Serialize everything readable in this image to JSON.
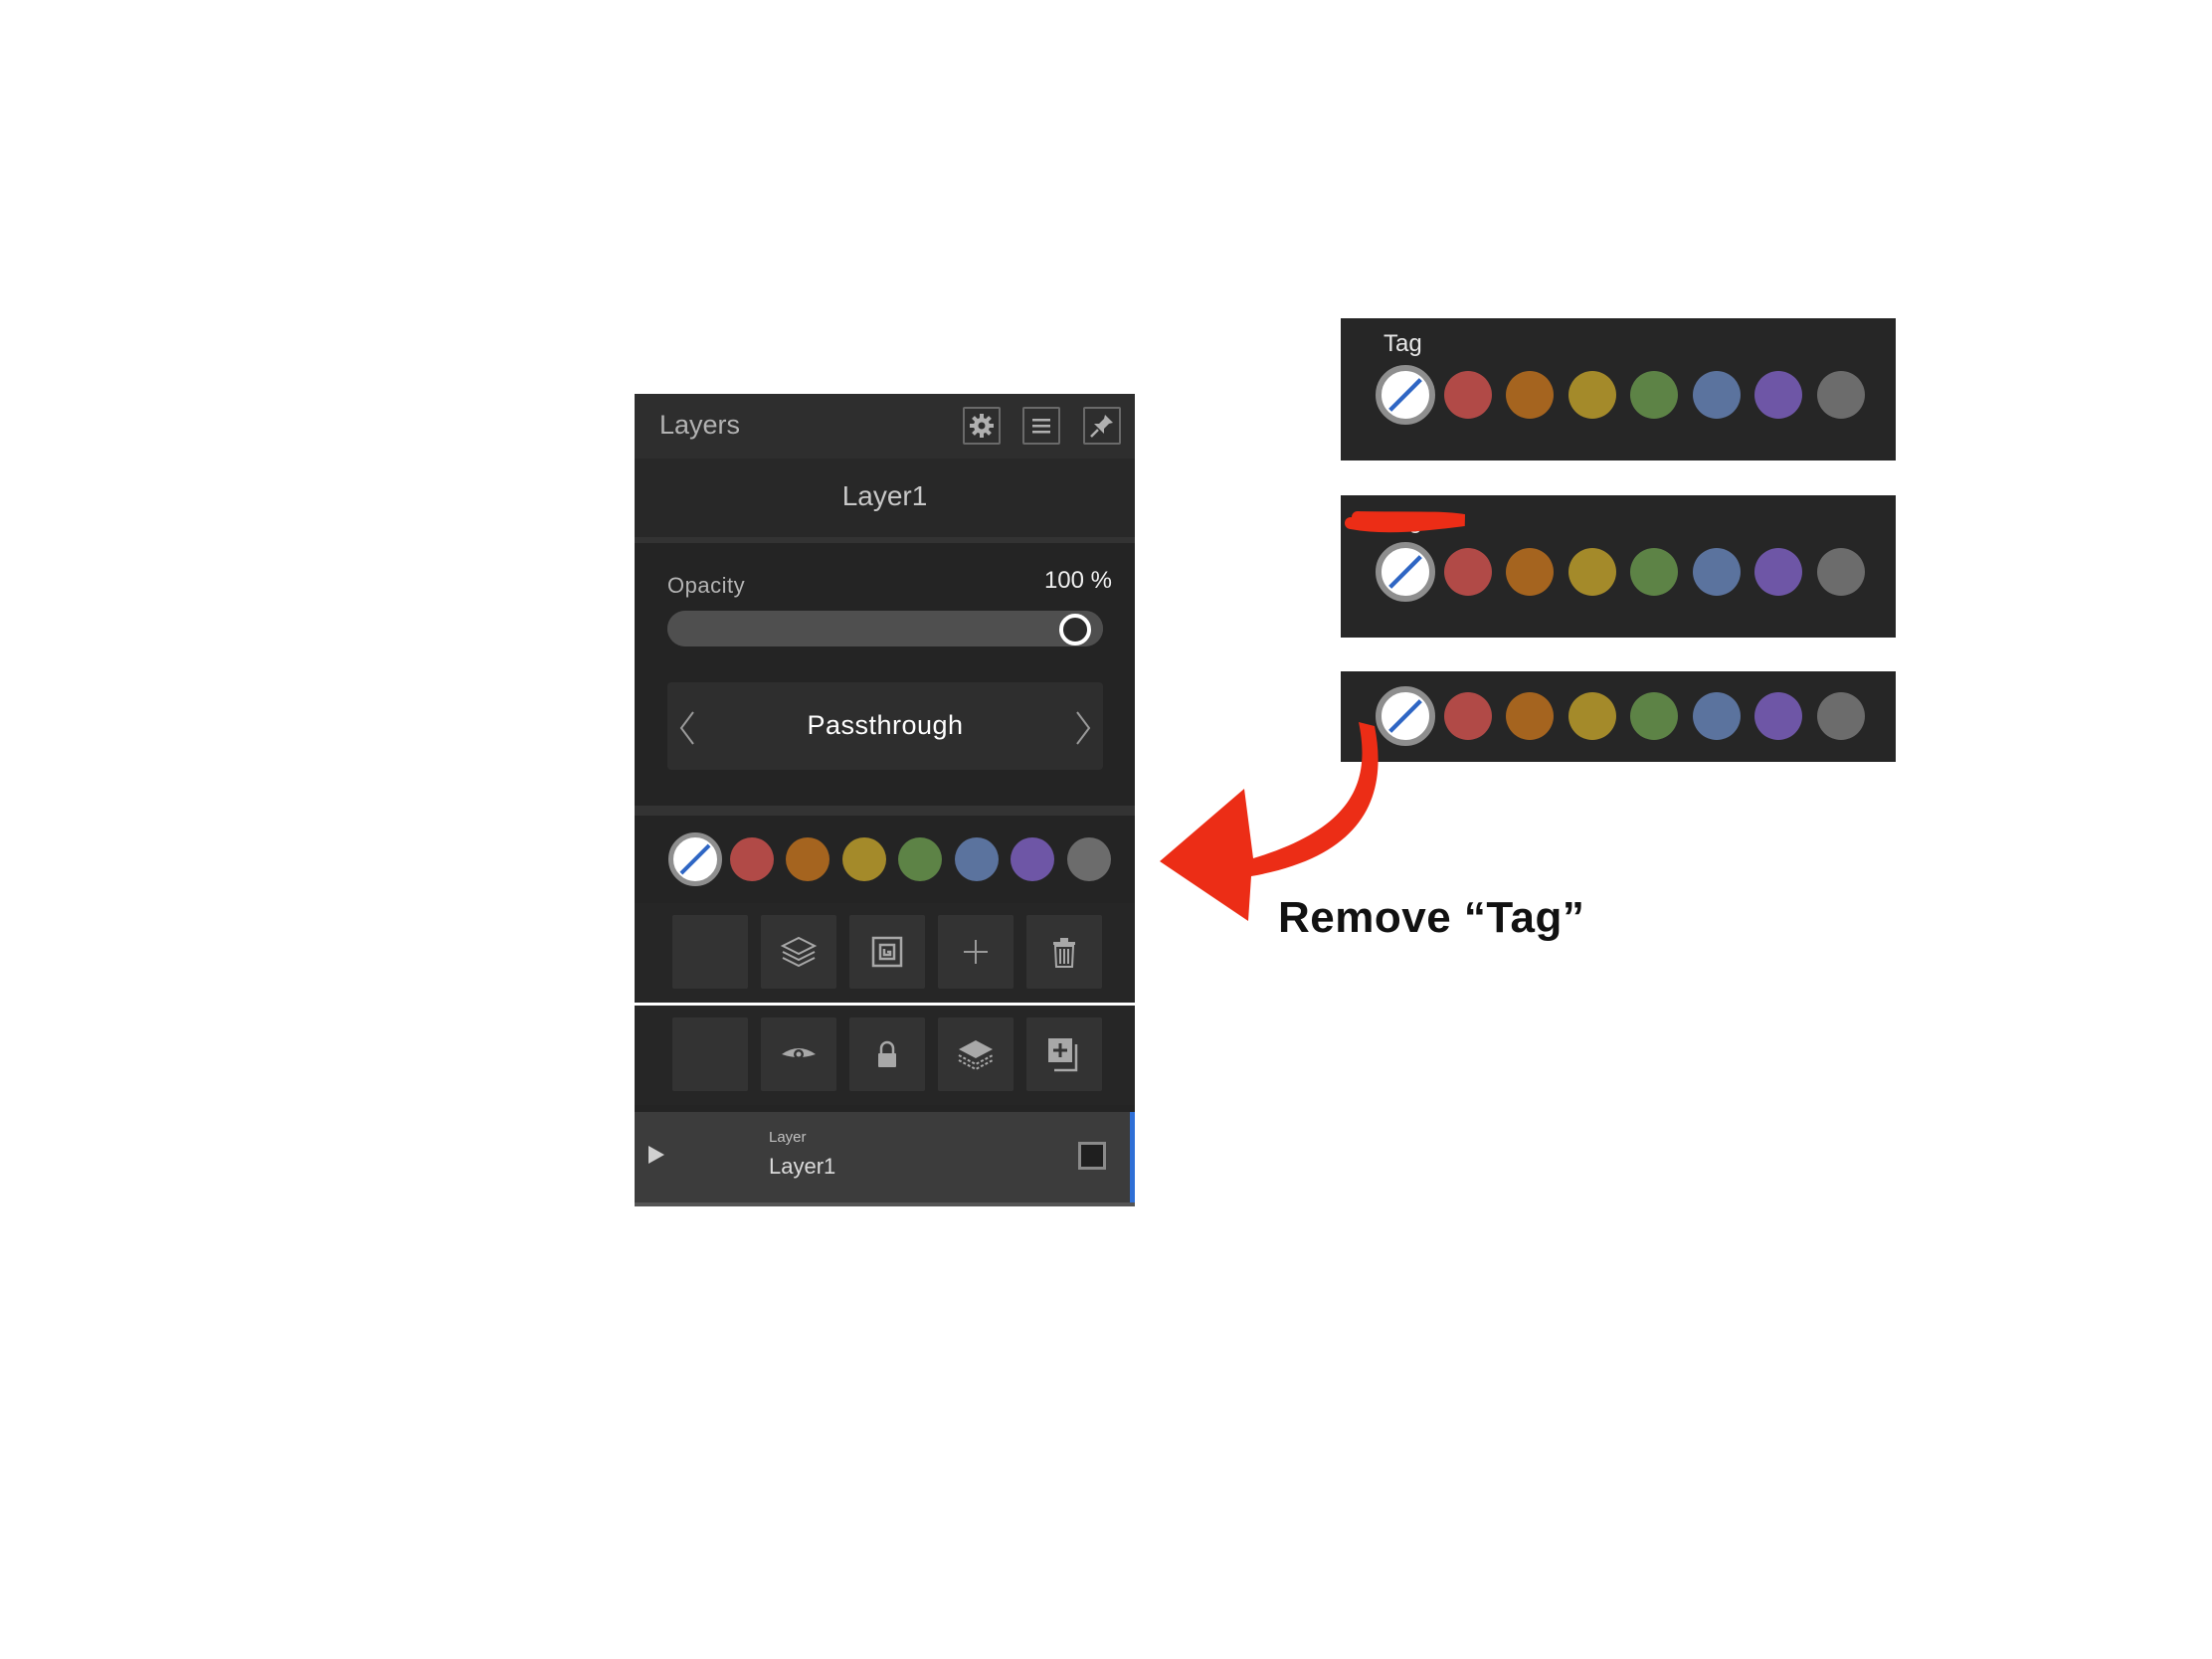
{
  "panel": {
    "title": "Layers",
    "layer_name": "Layer1",
    "opacity_label": "Opacity",
    "opacity_value": "100 %",
    "opacity_level": 1.0,
    "blend_mode": "Passthrough",
    "layer_item": {
      "type": "Layer",
      "name": "Layer1"
    }
  },
  "tag_colors": [
    "#b14a47",
    "#a5641f",
    "#a48a2a",
    "#5d8346",
    "#5b739e",
    "#6e56a6",
    "#6c6c6c"
  ],
  "examples": {
    "first_title": "Tag",
    "second_title": "Tag"
  },
  "annotation": {
    "text": "Remove “Tag”",
    "arrow_color": "#ec2d16"
  }
}
